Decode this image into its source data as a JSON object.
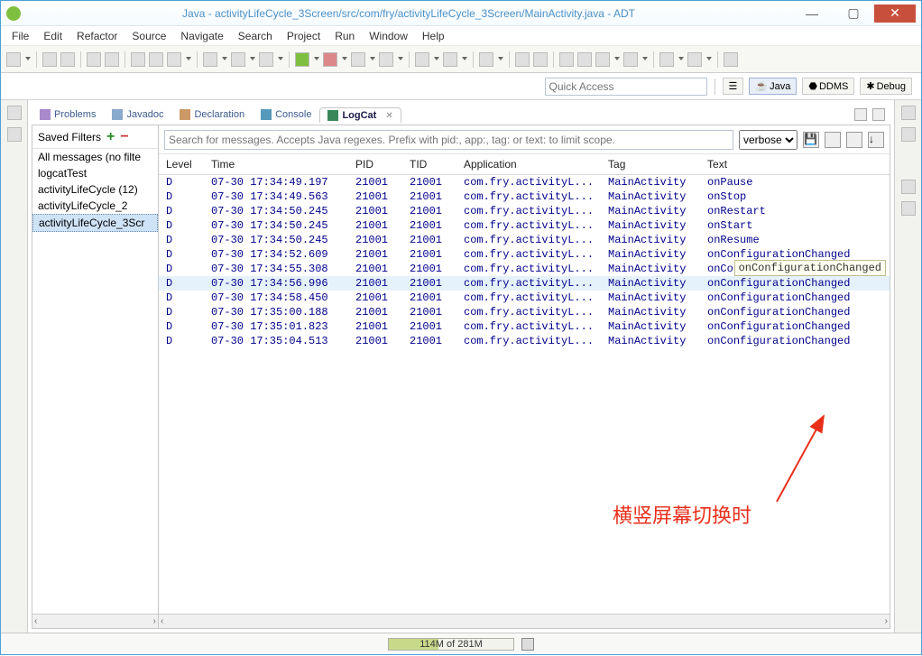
{
  "window": {
    "title": "Java - activityLifeCycle_3Screen/src/com/fry/activityLifeCycle_3Screen/MainActivity.java - ADT"
  },
  "menu": [
    "File",
    "Edit",
    "Refactor",
    "Source",
    "Navigate",
    "Search",
    "Project",
    "Run",
    "Window",
    "Help"
  ],
  "quick_access": {
    "placeholder": "Quick Access"
  },
  "perspectives": {
    "java": "Java",
    "ddms": "DDMS",
    "debug": "Debug"
  },
  "views": {
    "problems": "Problems",
    "javadoc": "Javadoc",
    "declaration": "Declaration",
    "console": "Console",
    "logcat": "LogCat"
  },
  "filters": {
    "header": "Saved Filters",
    "items": [
      "All messages (no filte",
      "logcatTest",
      "activityLifeCycle (12)",
      "activityLifeCycle_2",
      "activityLifeCycle_3Scr"
    ],
    "selected_index": 4
  },
  "search": {
    "placeholder": "Search for messages. Accepts Java regexes. Prefix with pid:, app:, tag: or text: to limit scope.",
    "level": "verbose"
  },
  "columns": {
    "level": "Level",
    "time": "Time",
    "pid": "PID",
    "tid": "TID",
    "app": "Application",
    "tag": "Tag",
    "text": "Text"
  },
  "rows": [
    {
      "level": "D",
      "time": "07-30 17:34:49.197",
      "pid": "21001",
      "tid": "21001",
      "app": "com.fry.activityL...",
      "tag": "MainActivity",
      "text": "onPause"
    },
    {
      "level": "D",
      "time": "07-30 17:34:49.563",
      "pid": "21001",
      "tid": "21001",
      "app": "com.fry.activityL...",
      "tag": "MainActivity",
      "text": "onStop"
    },
    {
      "level": "D",
      "time": "07-30 17:34:50.245",
      "pid": "21001",
      "tid": "21001",
      "app": "com.fry.activityL...",
      "tag": "MainActivity",
      "text": "onRestart"
    },
    {
      "level": "D",
      "time": "07-30 17:34:50.245",
      "pid": "21001",
      "tid": "21001",
      "app": "com.fry.activityL...",
      "tag": "MainActivity",
      "text": "onStart"
    },
    {
      "level": "D",
      "time": "07-30 17:34:50.245",
      "pid": "21001",
      "tid": "21001",
      "app": "com.fry.activityL...",
      "tag": "MainActivity",
      "text": "onResume"
    },
    {
      "level": "D",
      "time": "07-30 17:34:52.609",
      "pid": "21001",
      "tid": "21001",
      "app": "com.fry.activityL...",
      "tag": "MainActivity",
      "text": "onConfigurationChanged"
    },
    {
      "level": "D",
      "time": "07-30 17:34:55.308",
      "pid": "21001",
      "tid": "21001",
      "app": "com.fry.activityL...",
      "tag": "MainActivity",
      "text": "onConfigurationChanged",
      "tooltip": "onConfigurationChanged"
    },
    {
      "level": "D",
      "time": "07-30 17:34:56.996",
      "pid": "21001",
      "tid": "21001",
      "app": "com.fry.activityL...",
      "tag": "MainActivity",
      "text": "onConfigurationChanged",
      "selected": true
    },
    {
      "level": "D",
      "time": "07-30 17:34:58.450",
      "pid": "21001",
      "tid": "21001",
      "app": "com.fry.activityL...",
      "tag": "MainActivity",
      "text": "onConfigurationChanged"
    },
    {
      "level": "D",
      "time": "07-30 17:35:00.188",
      "pid": "21001",
      "tid": "21001",
      "app": "com.fry.activityL...",
      "tag": "MainActivity",
      "text": "onConfigurationChanged"
    },
    {
      "level": "D",
      "time": "07-30 17:35:01.823",
      "pid": "21001",
      "tid": "21001",
      "app": "com.fry.activityL...",
      "tag": "MainActivity",
      "text": "onConfigurationChanged"
    },
    {
      "level": "D",
      "time": "07-30 17:35:04.513",
      "pid": "21001",
      "tid": "21001",
      "app": "com.fry.activityL...",
      "tag": "MainActivity",
      "text": "onConfigurationChanged"
    }
  ],
  "annotation": {
    "text": "横竖屏幕切换时"
  },
  "status": {
    "mem": "114M of 281M"
  }
}
